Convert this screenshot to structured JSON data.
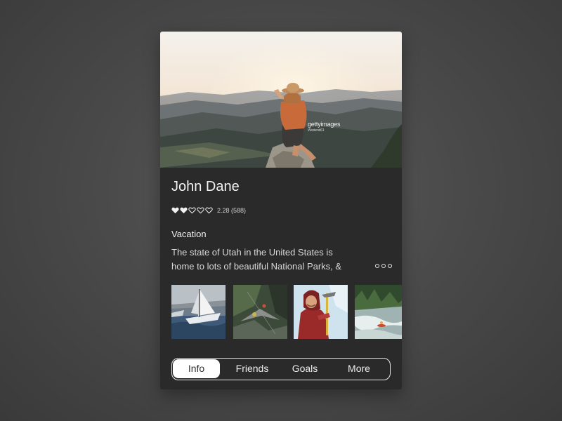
{
  "profile": {
    "name": "John Dane",
    "rating": {
      "value": 2,
      "max": 5,
      "text": "2.28 (588)"
    },
    "section_title": "Vacation",
    "description_line1": "The state of Utah in the United States is",
    "description_line2": "home to lots of beautiful National Parks, &"
  },
  "hero": {
    "watermark": "gettyimages",
    "watermark_sub": "Westend61"
  },
  "thumbnails": [
    {
      "name": "sailing-boat-thumbnail"
    },
    {
      "name": "cliff-hammock-thumbnail"
    },
    {
      "name": "ice-climber-thumbnail"
    },
    {
      "name": "whitewater-kayak-thumbnail"
    }
  ],
  "tabs": [
    {
      "label": "Info",
      "active": true
    },
    {
      "label": "Friends",
      "active": false
    },
    {
      "label": "Goals",
      "active": false
    },
    {
      "label": "More",
      "active": false
    }
  ],
  "colors": {
    "card_background": "#2a2a2a",
    "page_background": "#4a4a4a",
    "text_primary": "#f2f2f2",
    "tab_active_background": "#ffffff"
  },
  "icons": [
    "heart-filled-icon",
    "heart-outline-icon",
    "more-dots-icon"
  ]
}
